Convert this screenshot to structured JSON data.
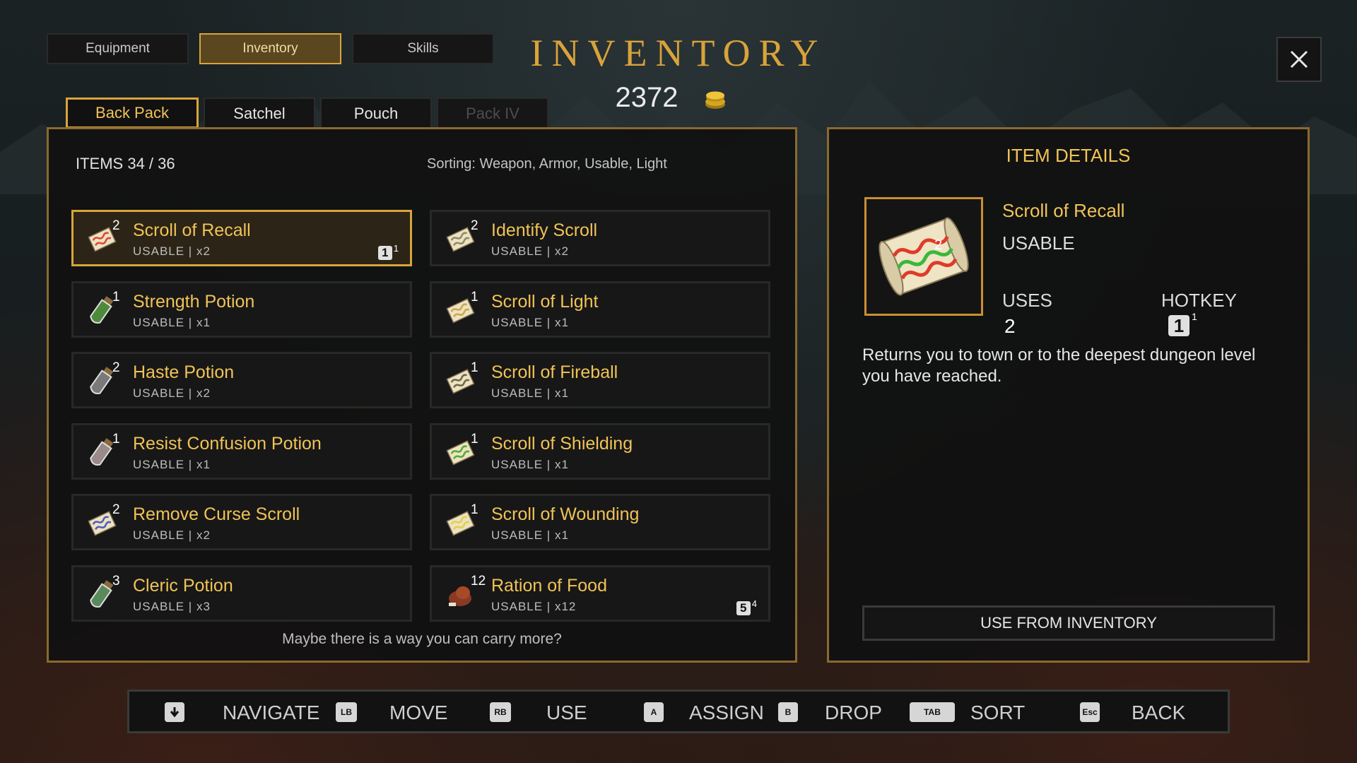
{
  "header": {
    "tabs": [
      {
        "label": "Equipment",
        "active": false
      },
      {
        "label": "Inventory",
        "active": true
      },
      {
        "label": "Skills",
        "active": false
      }
    ],
    "title": "INVENTORY",
    "gold": "2372"
  },
  "packs": [
    {
      "label": "Back Pack",
      "state": "active"
    },
    {
      "label": "Satchel",
      "state": "normal"
    },
    {
      "label": "Pouch",
      "state": "normal"
    },
    {
      "label": "Pack IV",
      "state": "disabled"
    }
  ],
  "items_panel": {
    "count": "ITEMS 34 / 36",
    "sorting": "Sorting: Weapon, Armor, Usable, Light",
    "footer": "Maybe there is a way you can carry more?",
    "items": [
      {
        "name": "Scroll of Recall",
        "sub": "USABLE | x2",
        "count": "2",
        "icon": "scroll-recall-icon",
        "color": "#d94a3a",
        "hotkey": "1",
        "hotkey_count": "1",
        "selected": true
      },
      {
        "name": "Identify Scroll",
        "sub": "USABLE | x2",
        "count": "2",
        "icon": "identify-scroll-icon",
        "color": "#8c8c6a"
      },
      {
        "name": "Strength Potion",
        "sub": "USABLE | x1",
        "count": "1",
        "icon": "strength-potion-icon",
        "color": "#4e8a3b"
      },
      {
        "name": "Scroll of Light",
        "sub": "USABLE | x1",
        "count": "1",
        "icon": "scroll-light-icon",
        "color": "#c9a94a"
      },
      {
        "name": "Haste Potion",
        "sub": "USABLE | x2",
        "count": "2",
        "icon": "haste-potion-icon",
        "color": "#7a7a7a"
      },
      {
        "name": "Scroll of Fireball",
        "sub": "USABLE | x1",
        "count": "1",
        "icon": "scroll-fireball-icon",
        "color": "#6a6a4a"
      },
      {
        "name": "Resist Confusion Potion",
        "sub": "USABLE | x1",
        "count": "1",
        "icon": "resist-confusion-potion-icon",
        "color": "#9a8a8a"
      },
      {
        "name": "Scroll of Shielding",
        "sub": "USABLE | x1",
        "count": "1",
        "icon": "scroll-shielding-icon",
        "color": "#4fae3a"
      },
      {
        "name": "Remove Curse Scroll",
        "sub": "USABLE | x2",
        "count": "2",
        "icon": "remove-curse-scroll-icon",
        "color": "#4a5fbf"
      },
      {
        "name": "Scroll of Wounding",
        "sub": "USABLE | x1",
        "count": "1",
        "icon": "scroll-wounding-icon",
        "color": "#e0d24a"
      },
      {
        "name": "Cleric Potion",
        "sub": "USABLE | x3",
        "count": "3",
        "icon": "cleric-potion-icon",
        "color": "#5a8a5a"
      },
      {
        "name": "Ration of Food",
        "sub": "USABLE | x12",
        "count": "12",
        "icon": "ration-food-icon",
        "color": "#8a3a22",
        "hotkey": "5",
        "hotkey_count": "4"
      }
    ]
  },
  "details": {
    "heading": "ITEM DETAILS",
    "name": "Scroll of Recall",
    "type": "USABLE",
    "count": "2",
    "uses_label": "USES",
    "uses_value": "2",
    "hotkey_label": "HOTKEY",
    "hotkey_key": "1",
    "hotkey_count": "1",
    "description": "Returns you to town or to the deepest dungeon level you have reached.",
    "action": "USE FROM INVENTORY"
  },
  "controls": [
    {
      "icon": "dpad-down-icon",
      "glyph": "",
      "label": "NAVIGATE"
    },
    {
      "icon": "lb-button-icon",
      "glyph": "LB",
      "label": "MOVE"
    },
    {
      "icon": "rb-button-icon",
      "glyph": "RB",
      "label": "USE"
    },
    {
      "icon": "a-button-icon",
      "glyph": "A",
      "label": "ASSIGN"
    },
    {
      "icon": "b-button-icon",
      "glyph": "B",
      "label": "DROP"
    },
    {
      "icon": "tab-key-icon",
      "glyph": "TAB",
      "label": "SORT"
    },
    {
      "icon": "esc-key-icon",
      "glyph": "Esc",
      "label": "BACK"
    }
  ]
}
